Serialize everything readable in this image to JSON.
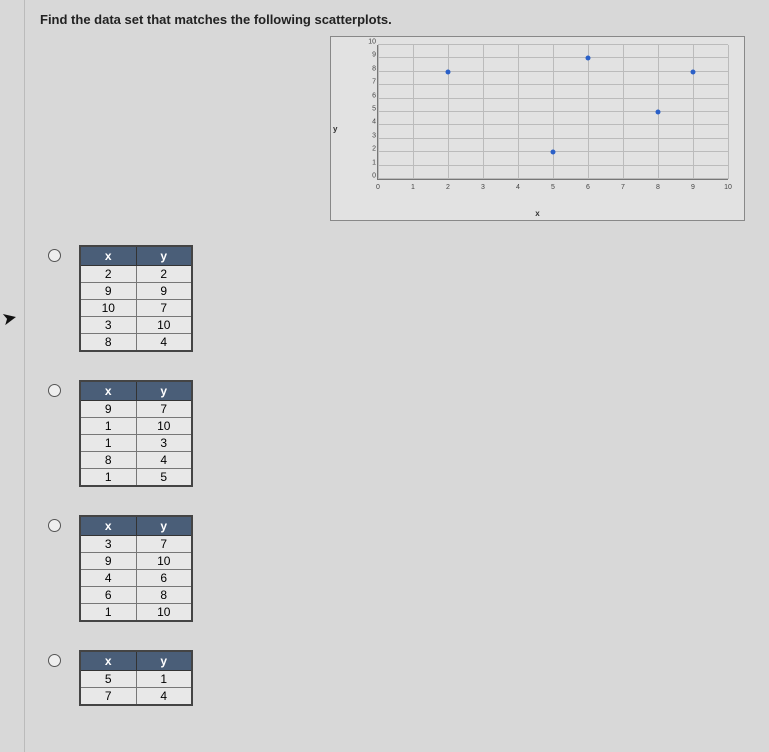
{
  "question": "Find the data set that matches the following scatterplots.",
  "chart_data": {
    "type": "scatter",
    "xlabel": "x",
    "ylabel": "y",
    "xlim": [
      0,
      10
    ],
    "ylim": [
      0,
      10
    ],
    "xticks": [
      0,
      1,
      2,
      3,
      4,
      5,
      6,
      7,
      8,
      9,
      10
    ],
    "yticks": [
      0,
      1,
      2,
      3,
      4,
      5,
      6,
      7,
      8,
      9,
      10
    ],
    "points": [
      {
        "x": 2,
        "y": 8
      },
      {
        "x": 5,
        "y": 2
      },
      {
        "x": 6,
        "y": 9
      },
      {
        "x": 8,
        "y": 5
      },
      {
        "x": 9,
        "y": 8
      }
    ]
  },
  "options": [
    {
      "headers": {
        "x": "x",
        "y": "y"
      },
      "rows": [
        {
          "x": "2",
          "y": "2"
        },
        {
          "x": "9",
          "y": "9"
        },
        {
          "x": "10",
          "y": "7"
        },
        {
          "x": "3",
          "y": "10"
        },
        {
          "x": "8",
          "y": "4"
        }
      ]
    },
    {
      "headers": {
        "x": "x",
        "y": "y"
      },
      "rows": [
        {
          "x": "9",
          "y": "7"
        },
        {
          "x": "1",
          "y": "10"
        },
        {
          "x": "1",
          "y": "3"
        },
        {
          "x": "8",
          "y": "4"
        },
        {
          "x": "1",
          "y": "5"
        }
      ]
    },
    {
      "headers": {
        "x": "x",
        "y": "y"
      },
      "rows": [
        {
          "x": "3",
          "y": "7"
        },
        {
          "x": "9",
          "y": "10"
        },
        {
          "x": "4",
          "y": "6"
        },
        {
          "x": "6",
          "y": "8"
        },
        {
          "x": "1",
          "y": "10"
        }
      ]
    },
    {
      "headers": {
        "x": "x",
        "y": "y"
      },
      "rows": [
        {
          "x": "5",
          "y": "1"
        },
        {
          "x": "7",
          "y": "4"
        }
      ]
    }
  ]
}
